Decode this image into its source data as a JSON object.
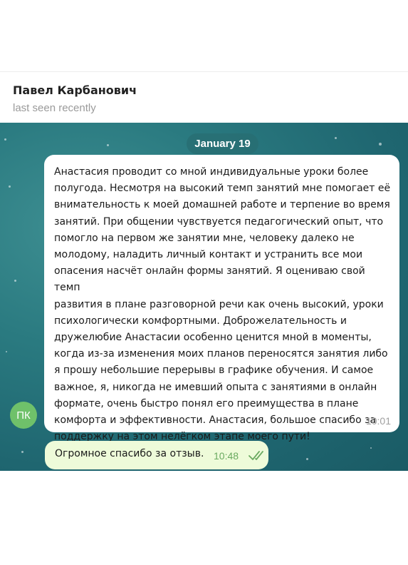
{
  "header": {
    "contact_name": "Павел Карбанович",
    "status": "last seen recently"
  },
  "chat": {
    "date_chip": "January 19",
    "incoming": {
      "avatar_initials": "ПК",
      "text": "Анастасия проводит со мной индивидуальные уроки более\nполугода. Несмотря на высокий темп занятий мне помогает её\nвнимательность к моей домашней работе и терпение во время\nзанятий. При общении чувствуется педагогический опыт, что\nпомогло на первом же занятии мне, человеку далеко не\nмолодому,  наладить личный контакт и устранить все мои\nопасения насчёт онлайн формы занятий. Я оцениваю свой темп\nразвития в плане разговорной речи как очень высокий, уроки\nпсихологически комфортными. Доброжелательность и\nдружелюбие Анастасии особенно ценится мной в моменты,\nкогда из-за изменения моих планов переносятся занятия либо\nя прошу небольшие перерывы в графике обучения. И самое\nважное, я, никогда не имевший опыта с занятиями в онлайн\nформате, очень быстро понял его преимущества в плане\nкомфорта и эффективности. Анастасия, большое спасибо за\nподдержку на этом нелёгком этапе моего пути!",
      "time": "10:01"
    },
    "outgoing": {
      "text": "Огромное спасибо за отзыв.",
      "time": "10:48",
      "status_icon": "double-check-icon"
    }
  },
  "colors": {
    "chat_background": "#2a7a80",
    "avatar": "#6fc16a",
    "outgoing_bubble": "#eefbd9",
    "outgoing_time": "#6aaa60"
  }
}
